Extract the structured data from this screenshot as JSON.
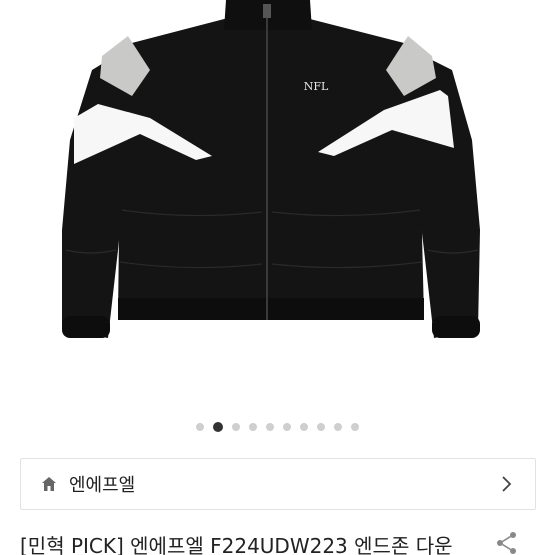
{
  "product": {
    "logo_text": "NFL",
    "title": "[민혁 PICK] 엔에프엘 F224UDW223 엔드존 다운"
  },
  "carousel": {
    "total": 10,
    "active_index": 1
  },
  "brand": {
    "name": "엔에프엘",
    "icon": "home-icon",
    "action_icon": "chevron-right-icon"
  },
  "actions": {
    "share_icon": "share-icon"
  },
  "colors": {
    "jacket": "#141414",
    "gray_panel": "#c9c9c7",
    "white_panel": "#f7f7f7",
    "dot_active": "#333333",
    "dot_inactive": "#cfcfcf"
  }
}
